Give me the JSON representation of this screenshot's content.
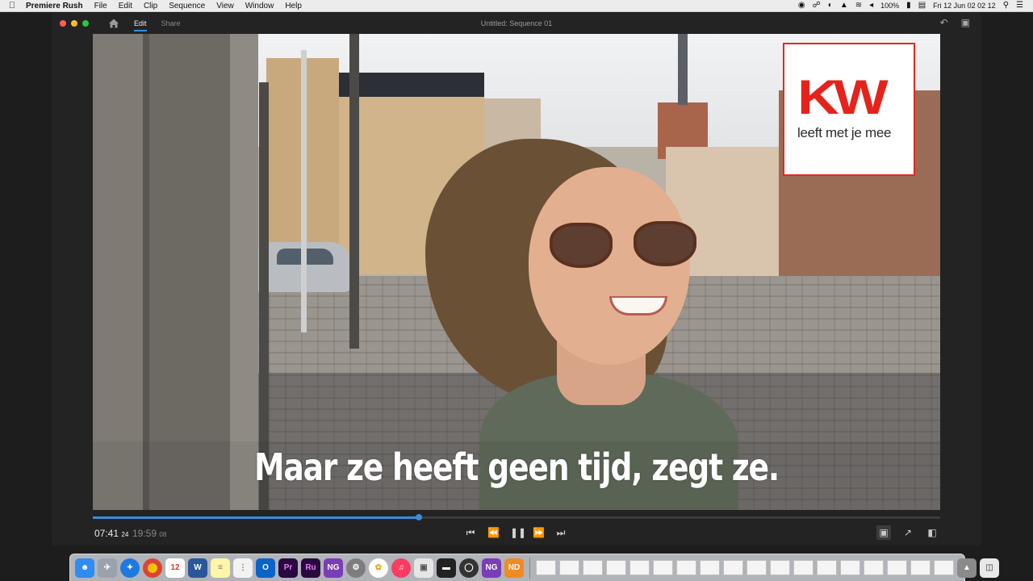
{
  "menubar": {
    "apple_icon": "apple-icon",
    "app_name": "Premiere Rush",
    "items": [
      "File",
      "Edit",
      "Clip",
      "Sequence",
      "View",
      "Window",
      "Help"
    ],
    "battery": "100%",
    "datetime": "Fri 12 Jun  02 02 12"
  },
  "window": {
    "tabs": [
      {
        "label": "Edit",
        "active": true
      },
      {
        "label": "Share",
        "active": false
      }
    ],
    "title": "Untitled: Sequence 01",
    "traffic_lights": {
      "close": "#ff5f57",
      "minimize": "#febc2e",
      "zoom": "#28c840"
    }
  },
  "video": {
    "logo_text": "KW",
    "logo_tagline": "leeft met je mee",
    "logo_color": "#e5231b",
    "subtitle": "Maar ze heeft geen tijd, zegt ze."
  },
  "playback": {
    "current_time": "07:41",
    "current_frames": "24",
    "total_time": "19:59",
    "total_frames": "08",
    "progress": 0.385,
    "accent": "#3a8dde"
  }
}
